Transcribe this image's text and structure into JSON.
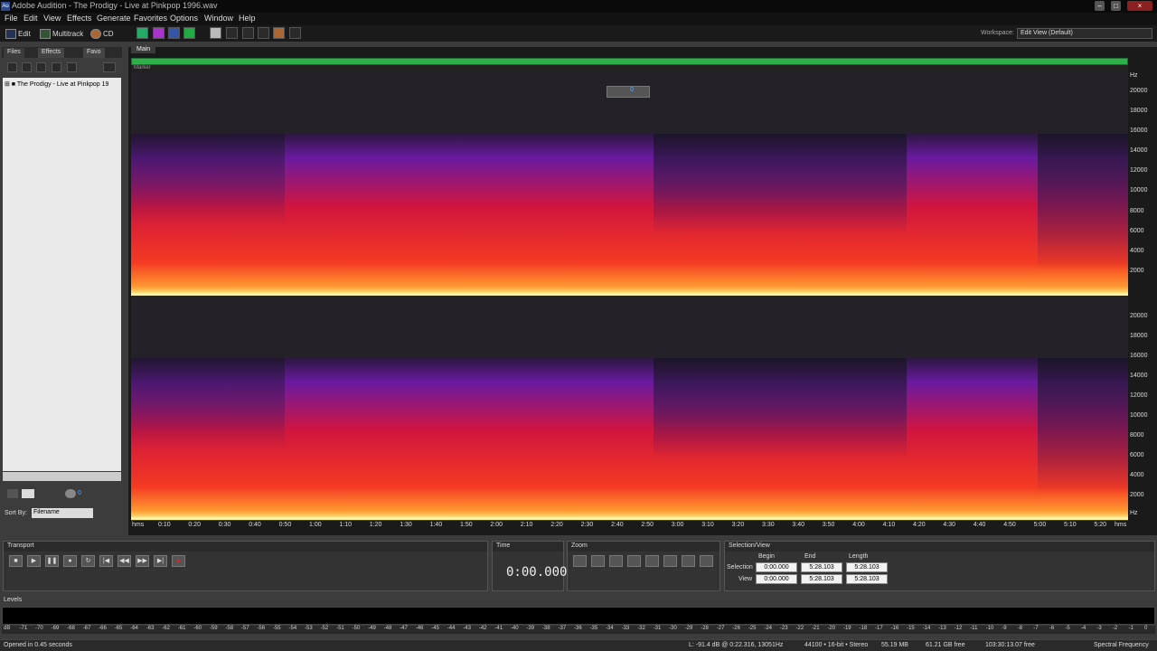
{
  "app": {
    "title": "Adobe Audition - The Prodigy - Live at Pinkpop 1996.wav",
    "icon_text": "Au"
  },
  "menu": [
    "File",
    "Edit",
    "View",
    "Effects",
    "Generate",
    "Favorites",
    "Options",
    "Window",
    "Help"
  ],
  "toolbar": {
    "edit": "Edit",
    "multitrack": "Multitrack",
    "cd": "CD",
    "workspace_label": "Workspace:",
    "workspace_value": "Edit View (Default)"
  },
  "left": {
    "tabs": [
      "Files",
      "Effects",
      "Favo"
    ],
    "file_item": "The Prodigy - Live at Pinkpop 19",
    "sort_label": "Sort By:",
    "sort_value": "Filename",
    "vol_value": "0"
  },
  "main": {
    "tab": "Main",
    "marker": "Marker",
    "vol_value": "0"
  },
  "ruler": {
    "unit": "Hz",
    "top_labels": [
      "20000",
      "18000",
      "16000",
      "14000",
      "12000",
      "10000",
      "8000",
      "6000",
      "4000",
      "2000"
    ],
    "bottom_labels": [
      "20000",
      "18000",
      "16000",
      "14000",
      "12000",
      "10000",
      "8000",
      "6000",
      "4000",
      "2000"
    ],
    "bottom_unit": "Hz"
  },
  "timeline": {
    "labels": [
      "hms",
      "0:10",
      "0:20",
      "0:30",
      "0:40",
      "0:50",
      "1:00",
      "1:10",
      "1:20",
      "1:30",
      "1:40",
      "1:50",
      "2:00",
      "2:10",
      "2:20",
      "2:30",
      "2:40",
      "2:50",
      "3:00",
      "3:10",
      "3:20",
      "3:30",
      "3:40",
      "3:50",
      "4:00",
      "4:10",
      "4:20",
      "4:30",
      "4:40",
      "4:50",
      "5:00",
      "5:10",
      "5:20",
      "hms"
    ]
  },
  "transport": {
    "title": "Transport"
  },
  "time": {
    "title": "Time",
    "value": "0:00.000"
  },
  "zoom": {
    "title": "Zoom"
  },
  "selview": {
    "title": "Selection/View",
    "col_begin": "Begin",
    "col_end": "End",
    "col_length": "Length",
    "row_sel": "Selection",
    "row_view": "View",
    "sel_begin": "0:00.000",
    "sel_end": "5:28.103",
    "sel_length": "5:28.103",
    "view_begin": "0:00.000",
    "view_end": "5:28.103",
    "view_length": "5:28.103"
  },
  "levels": {
    "title": "Levels",
    "scale": [
      "dB",
      "-71",
      "-70",
      "-69",
      "-68",
      "-67",
      "-66",
      "-65",
      "-64",
      "-63",
      "-62",
      "-61",
      "-60",
      "-59",
      "-58",
      "-57",
      "-56",
      "-55",
      "-54",
      "-53",
      "-52",
      "-51",
      "-50",
      "-49",
      "-48",
      "-47",
      "-46",
      "-45",
      "-44",
      "-43",
      "-42",
      "-41",
      "-40",
      "-39",
      "-38",
      "-37",
      "-36",
      "-35",
      "-34",
      "-33",
      "-32",
      "-31",
      "-30",
      "-29",
      "-28",
      "-27",
      "-26",
      "-25",
      "-24",
      "-23",
      "-22",
      "-21",
      "-20",
      "-19",
      "-18",
      "-17",
      "-16",
      "-15",
      "-14",
      "-13",
      "-12",
      "-11",
      "-10",
      "-9",
      "-8",
      "-7",
      "-6",
      "-5",
      "-4",
      "-3",
      "-2",
      "-1",
      "0"
    ]
  },
  "status": {
    "left": "Opened in 0.45 seconds",
    "cursor": "L: -91.4 dB @ 0:22.316, 13051Hz",
    "format": "44100 • 16-bit • Stereo",
    "size": "55.19 MB",
    "free": "61.21 GB free",
    "time_free": "103:30:13.07 free",
    "view": "Spectral Frequency"
  }
}
